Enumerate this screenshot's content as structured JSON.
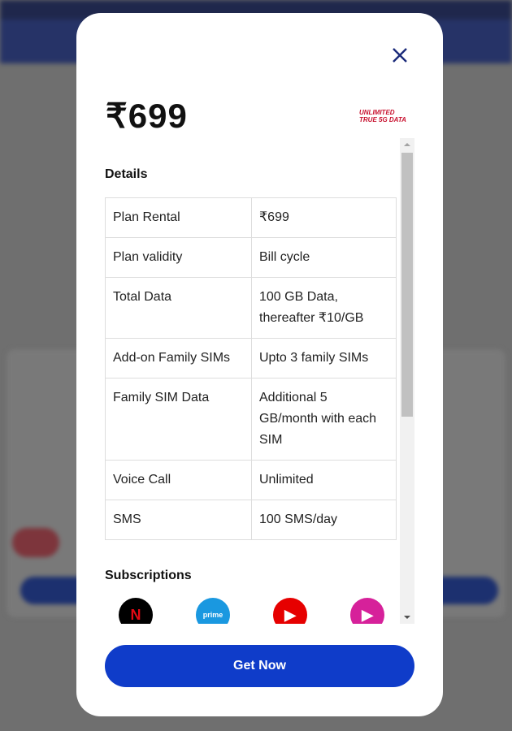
{
  "modal": {
    "price": "₹699",
    "badge_line1": "UNLIMITED",
    "badge_line2": "TRUE 5G DATA",
    "details_title": "Details",
    "details": [
      {
        "label": "Plan Rental",
        "value": "₹699"
      },
      {
        "label": "Plan validity",
        "value": "Bill cycle"
      },
      {
        "label": "Total Data",
        "value": "100 GB Data, thereafter ₹10/GB"
      },
      {
        "label": "Add-on Family SIMs",
        "value": "Upto 3 family SIMs"
      },
      {
        "label": "Family SIM Data",
        "value": "Additional 5 GB/month with each SIM"
      },
      {
        "label": "Voice Call",
        "value": "Unlimited"
      },
      {
        "label": "SMS",
        "value": "100 SMS/day"
      }
    ],
    "subscriptions_title": "Subscriptions",
    "subscriptions": [
      {
        "icon": "netflix-icon",
        "text": "N",
        "color": "#000000"
      },
      {
        "icon": "amazon-prime-icon",
        "text": "prime",
        "color": "#1a98e0"
      },
      {
        "icon": "youtube-icon",
        "text": "▶",
        "color": "#e60000"
      },
      {
        "icon": "jiocinema-icon",
        "text": "▶",
        "color": "#d6219a"
      }
    ],
    "cta_label": "Get Now"
  },
  "colors": {
    "accent": "#0f3cc9",
    "badge": "#c8102e",
    "close": "#1a2a7a"
  }
}
